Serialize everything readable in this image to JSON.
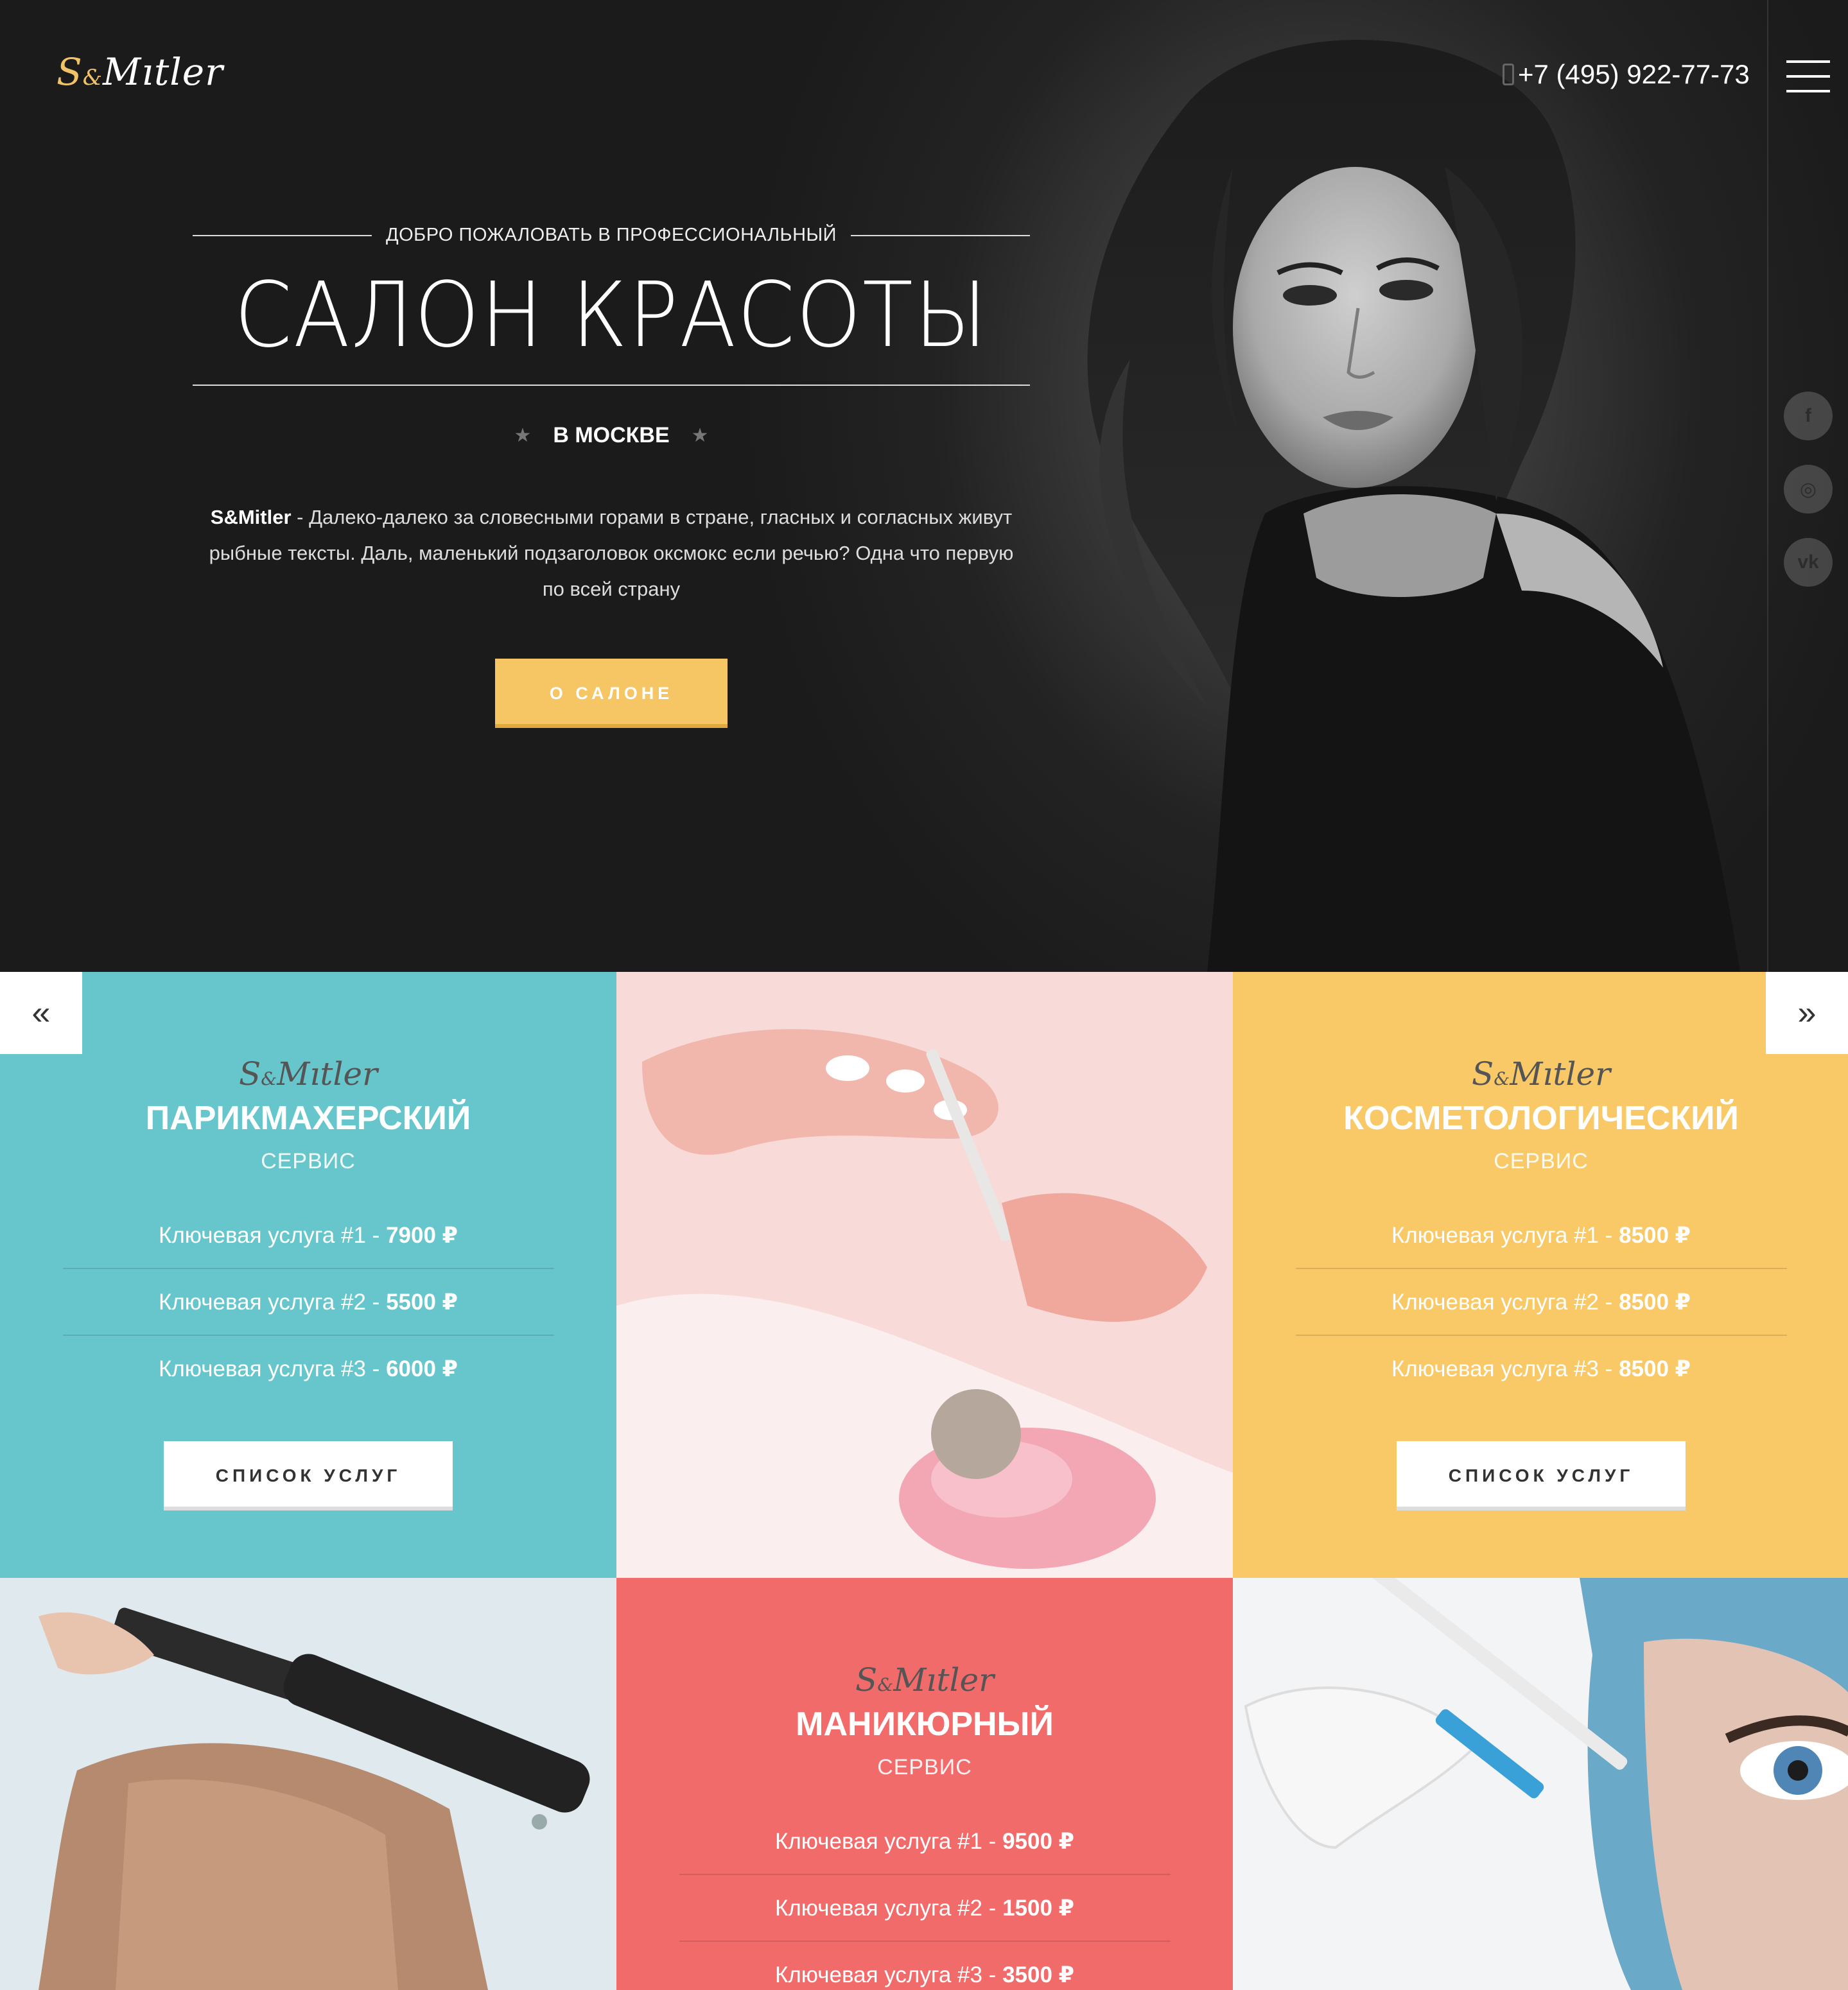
{
  "header": {
    "logo_s": "S",
    "logo_amp": "&",
    "logo_rest": "Mıtler",
    "phone": "+7 (495) 922-77-73"
  },
  "socials": [
    {
      "name": "facebook",
      "glyph": "f"
    },
    {
      "name": "instagram",
      "glyph": "◎"
    },
    {
      "name": "vk",
      "glyph": "vk"
    }
  ],
  "hero": {
    "welcome": "ДОБРО ПОЖАЛОВАТЬ В ПРОФЕССИОНАЛЬНЫЙ",
    "title": "САЛОН КРАСОТЫ",
    "city": "В МОСКВЕ",
    "brand": "S&Mitler",
    "description": " - Далеко-далеко за словесными горами в стране, гласных и согласных живут рыбные тексты. Даль, маленький подзаголовок оксмокс если речью? Одна что первую по всей страну",
    "button": "О САЛОНЕ"
  },
  "carousel": {
    "prev": "«",
    "next": "»"
  },
  "services": [
    {
      "logo_s": "S",
      "logo_amp": "&",
      "logo_rest": "Mıtler",
      "title": "ПАРИКМАХЕРСКИЙ",
      "subtitle": "СЕРВИС",
      "items": [
        {
          "label": "Ключевая услуга #1 - ",
          "price": "7900 ₽"
        },
        {
          "label": "Ключевая услуга #2 - ",
          "price": "5500 ₽"
        },
        {
          "label": "Ключевая услуга #3 - ",
          "price": "6000 ₽"
        }
      ],
      "button": "СПИСОК УСЛУГ",
      "color": "#67c6cc"
    },
    {
      "logo_s": "S",
      "logo_amp": "&",
      "logo_rest": "Mıtler",
      "title": "КОСМЕТОЛОГИЧЕСКИЙ",
      "subtitle": "СЕРВИС",
      "items": [
        {
          "label": "Ключевая услуга #1 - ",
          "price": "8500 ₽"
        },
        {
          "label": "Ключевая услуга #2 - ",
          "price": "8500 ₽"
        },
        {
          "label": "Ключевая услуга #3 - ",
          "price": "8500 ₽"
        }
      ],
      "button": "СПИСОК УСЛУГ",
      "color": "#f8c966"
    },
    {
      "logo_s": "S",
      "logo_amp": "&",
      "logo_rest": "Mıtler",
      "title": "МАНИКЮРНЫЙ",
      "subtitle": "СЕРВИС",
      "items": [
        {
          "label": "Ключевая услуга #1 - ",
          "price": "9500 ₽"
        },
        {
          "label": "Ключевая услуга #2 - ",
          "price": "1500 ₽"
        },
        {
          "label": "Ключевая услуга #3 - ",
          "price": "3500 ₽"
        }
      ],
      "color": "#f26b6b"
    }
  ],
  "colors": {
    "accent_gold": "#f6c665",
    "teal": "#67c6cc",
    "yellow": "#f8c966",
    "coral": "#f26b6b"
  }
}
